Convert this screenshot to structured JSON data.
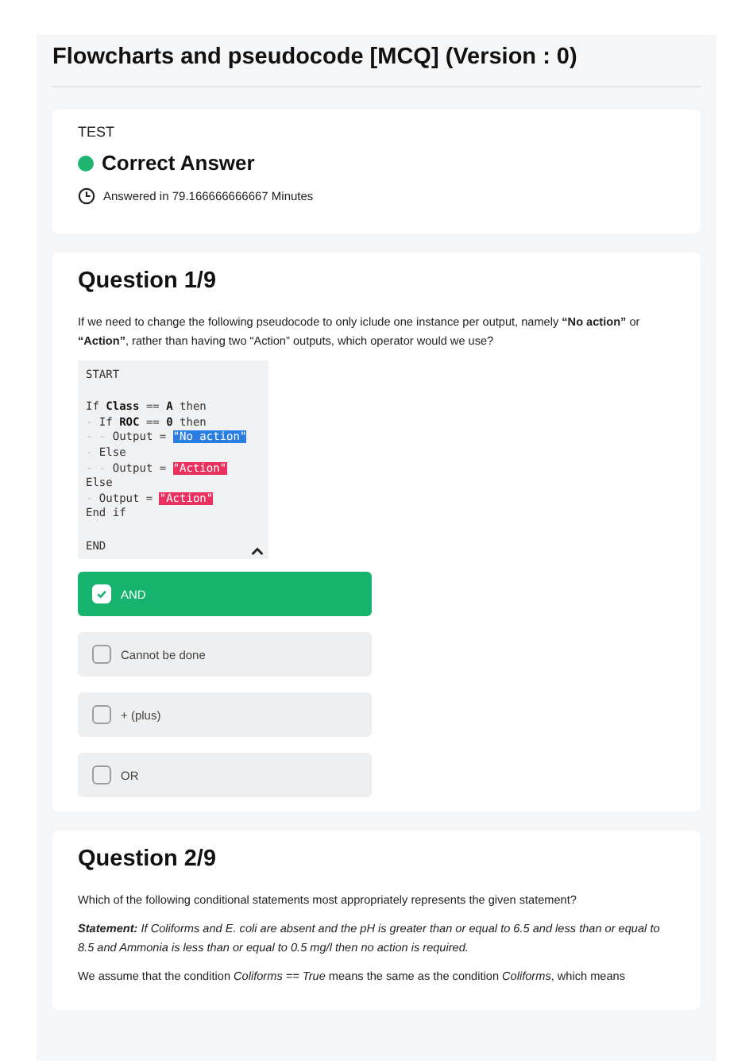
{
  "page": {
    "title": "Flowcharts and pseudocode [MCQ] (Version : 0)"
  },
  "summary": {
    "label": "TEST",
    "result": "Correct Answer",
    "correct": true,
    "time": "Answered in 79.166666666667 Minutes"
  },
  "questions": [
    {
      "heading": "Question 1/9",
      "paragraphs": [
        {
          "kind": "plain",
          "text": "If we need to change the following pseudocode to only iclude one instance per output, namely **“No action”** or **“Action”**, rather than having two “Action” outputs, which operator would we use?"
        }
      ],
      "code": {
        "expanded": true,
        "lines": [
          [
            {
              "kind": "plain",
              "text": "START"
            }
          ],
          [
            {
              "kind": "spacer"
            }
          ],
          [
            {
              "kind": "plain",
              "text": "If "
            },
            {
              "kind": "bold",
              "text": "Class"
            },
            {
              "kind": "plain",
              "text": " == "
            },
            {
              "kind": "bold",
              "text": "A"
            },
            {
              "kind": "plain",
              "text": " then"
            }
          ],
          [
            {
              "kind": "dash",
              "text": "-"
            },
            {
              "kind": "plain",
              "text": " If "
            },
            {
              "kind": "bold",
              "text": "ROC"
            },
            {
              "kind": "plain",
              "text": " == "
            },
            {
              "kind": "bold",
              "text": "0"
            },
            {
              "kind": "plain",
              "text": " then"
            }
          ],
          [
            {
              "kind": "dash",
              "text": "- -"
            },
            {
              "kind": "plain",
              "text": " Output = "
            },
            {
              "kind": "blue",
              "text": "\"No action\""
            }
          ],
          [
            {
              "kind": "dash",
              "text": "-"
            },
            {
              "kind": "plain",
              "text": " Else"
            }
          ],
          [
            {
              "kind": "dash",
              "text": "- -"
            },
            {
              "kind": "plain",
              "text": " Output = "
            },
            {
              "kind": "red",
              "text": "\"Action\""
            }
          ],
          [
            {
              "kind": "plain",
              "text": "Else"
            }
          ],
          [
            {
              "kind": "dash",
              "text": "-"
            },
            {
              "kind": "plain",
              "text": " Output = "
            },
            {
              "kind": "red",
              "text": "\"Action\""
            }
          ],
          [
            {
              "kind": "plain",
              "text": "End if"
            }
          ],
          [
            {
              "kind": "spacer"
            }
          ],
          [
            {
              "kind": "plain",
              "text": "END"
            }
          ]
        ]
      },
      "options": [
        {
          "label": "AND",
          "selected": true
        },
        {
          "label": "Cannot be done",
          "selected": false
        },
        {
          "label": "+ (plus)",
          "selected": false
        },
        {
          "label": "OR",
          "selected": false
        }
      ]
    },
    {
      "heading": "Question 2/9",
      "paragraphs": [
        {
          "kind": "plain",
          "text": "Which of the following conditional statements most appropriately represents the given statement?"
        },
        {
          "kind": "italic",
          "text": "**Statement:** If Coliforms and E. coli are absent and the pH is greater than or equal to 6.5 and less than or equal to 8.5 and Ammonia is less than or equal to 0.5 mg/l then no action is required."
        },
        {
          "kind": "plain",
          "text": "We assume that the condition *Coliforms == True* means the same as the condition *Coliforms*, which means"
        }
      ]
    }
  ]
}
